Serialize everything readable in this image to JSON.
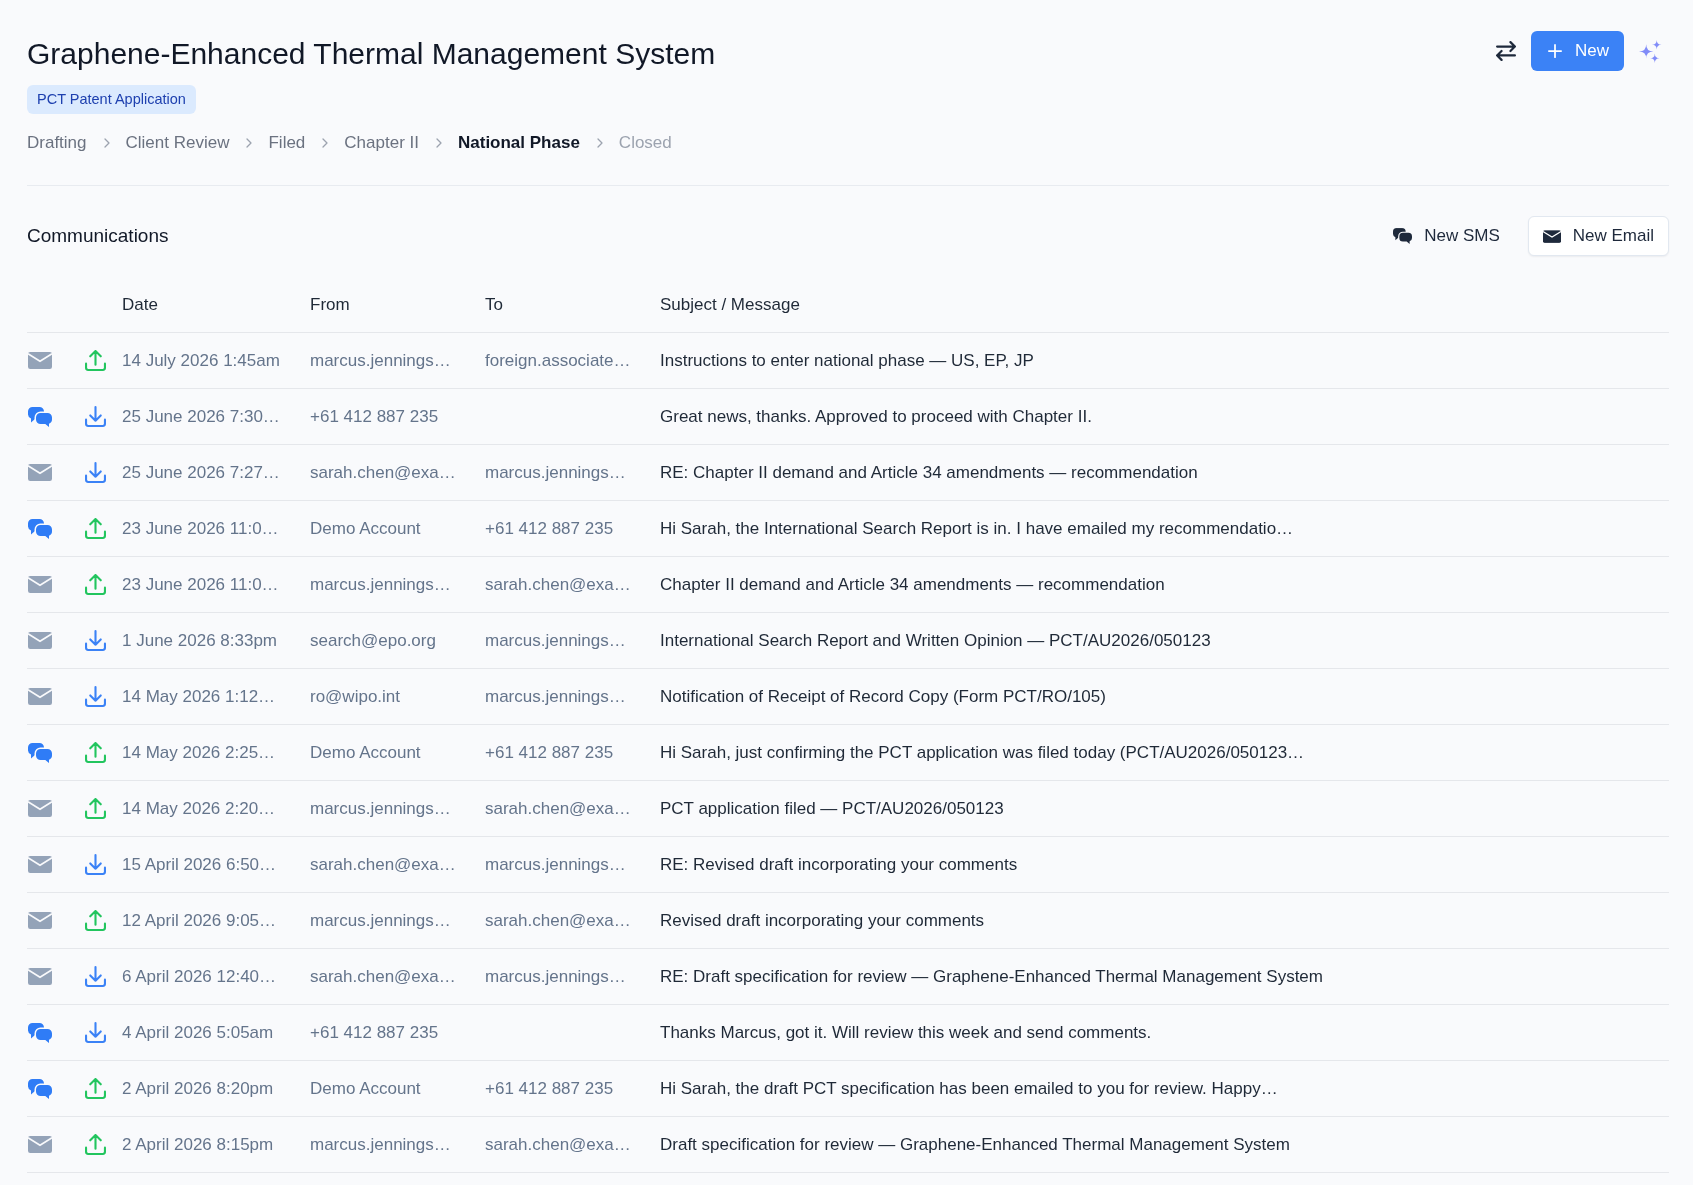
{
  "header": {
    "title": "Graphene-Enhanced Thermal Management System",
    "badge": "PCT Patent Application",
    "new_button": "New"
  },
  "stages": [
    {
      "label": "Drafting",
      "completed": true,
      "selected": false
    },
    {
      "label": "Client Review",
      "completed": true,
      "selected": false
    },
    {
      "label": "Filed",
      "completed": true,
      "selected": false
    },
    {
      "label": "Chapter II",
      "completed": true,
      "selected": false
    },
    {
      "label": "National Phase",
      "completed": false,
      "selected": true
    },
    {
      "label": "Closed",
      "completed": false,
      "selected": false
    }
  ],
  "communications": {
    "title": "Communications",
    "actions": [
      {
        "kind": "sms",
        "label": "New SMS"
      },
      {
        "kind": "email",
        "label": "New Email"
      }
    ],
    "columns": [
      "Date",
      "From",
      "To",
      "Subject / Message"
    ],
    "rows": [
      {
        "kind": "email",
        "outgoing": true,
        "date": "14 July 2026 1:45am",
        "from": "marcus.jennings…",
        "to": "foreign.associate…",
        "subject": "Instructions to enter national phase — US, EP, JP"
      },
      {
        "kind": "sms",
        "outgoing": false,
        "date": "25 June 2026 7:30…",
        "from": "+61 412 887 235",
        "subject": "Great news, thanks. Approved to proceed with Chapter II."
      },
      {
        "kind": "email",
        "outgoing": false,
        "date": "25 June 2026 7:27…",
        "from": "sarah.chen@exa…",
        "to": "marcus.jennings…",
        "subject": "RE: Chapter II demand and Article 34 amendments — recommendation"
      },
      {
        "kind": "sms",
        "outgoing": true,
        "date": "23 June 2026 11:0…",
        "from": "Demo Account",
        "to": "+61 412 887 235",
        "subject": "Hi Sarah, the International Search Report is in. I have emailed my recommendatio…"
      },
      {
        "kind": "email",
        "outgoing": true,
        "date": "23 June 2026 11:0…",
        "from": "marcus.jennings…",
        "to": "sarah.chen@exa…",
        "subject": "Chapter II demand and Article 34 amendments — recommendation"
      },
      {
        "kind": "email",
        "outgoing": false,
        "date": "1 June 2026 8:33pm",
        "from": "search@epo.org",
        "to": "marcus.jennings…",
        "subject": "International Search Report and Written Opinion — PCT/AU2026/050123"
      },
      {
        "kind": "email",
        "outgoing": false,
        "date": "14 May 2026 1:12…",
        "from": "ro@wipo.int",
        "to": "marcus.jennings…",
        "subject": "Notification of Receipt of Record Copy (Form PCT/RO/105)"
      },
      {
        "kind": "sms",
        "outgoing": true,
        "date": "14 May 2026 2:25…",
        "from": "Demo Account",
        "to": "+61 412 887 235",
        "subject": "Hi Sarah, just confirming the PCT application was filed today (PCT/AU2026/050123…"
      },
      {
        "kind": "email",
        "outgoing": true,
        "date": "14 May 2026 2:20…",
        "from": "marcus.jennings…",
        "to": "sarah.chen@exa…",
        "subject": "PCT application filed — PCT/AU2026/050123"
      },
      {
        "kind": "email",
        "outgoing": false,
        "date": "15 April 2026 6:50…",
        "from": "sarah.chen@exa…",
        "to": "marcus.jennings…",
        "subject": "RE: Revised draft incorporating your comments"
      },
      {
        "kind": "email",
        "outgoing": true,
        "date": "12 April 2026 9:05…",
        "from": "marcus.jennings…",
        "to": "sarah.chen@exa…",
        "subject": "Revised draft incorporating your comments"
      },
      {
        "kind": "email",
        "outgoing": false,
        "date": "6 April 2026 12:40…",
        "from": "sarah.chen@exa…",
        "to": "marcus.jennings…",
        "subject": "RE: Draft specification for review — Graphene-Enhanced Thermal Management System"
      },
      {
        "kind": "sms",
        "outgoing": false,
        "date": "4 April 2026 5:05am",
        "from": "+61 412 887 235",
        "subject": "Thanks Marcus, got it. Will review this week and send comments."
      },
      {
        "kind": "sms",
        "outgoing": true,
        "date": "2 April 2026 8:20pm",
        "from": "Demo Account",
        "to": "+61 412 887 235",
        "subject": "Hi Sarah, the draft PCT specification has been emailed to you for review. Happy…"
      },
      {
        "kind": "email",
        "outgoing": true,
        "date": "2 April 2026 8:15pm",
        "from": "marcus.jennings…",
        "to": "sarah.chen@exa…",
        "subject": "Draft specification for review — Graphene-Enhanced Thermal Management System"
      }
    ]
  }
}
